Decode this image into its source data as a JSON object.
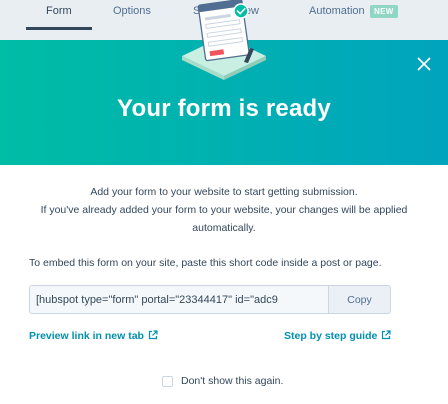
{
  "tabs": {
    "form": "Form",
    "options": "Options",
    "style": "Styl",
    "preview": "view",
    "automation": "Automation",
    "new_badge": "NEW"
  },
  "modal": {
    "title": "Your form is ready",
    "intro_line1": "Add your form to your website to start getting submission.",
    "intro_line2": "If you've already added your form to your website, your changes will be applied",
    "intro_line3": "automatically.",
    "embed_instructions": "To embed this form on your site, paste this short code inside a post or page.",
    "shortcode_value": "[hubspot type=\"form\" portal=\"23344417\" id=\"adc9",
    "copy_label": "Copy",
    "preview_link": "Preview link in new tab",
    "guide_link": "Step by step guide",
    "dont_show_label": "Don't show this again.",
    "dont_show_checked": false
  },
  "icons": {
    "close": "close-icon",
    "external_link": "external-link-icon",
    "illustration": "form-illustration"
  },
  "colors": {
    "header_start": "#00bda5",
    "header_end": "#00a4bd",
    "link": "#0091ae",
    "text": "#33475b"
  }
}
